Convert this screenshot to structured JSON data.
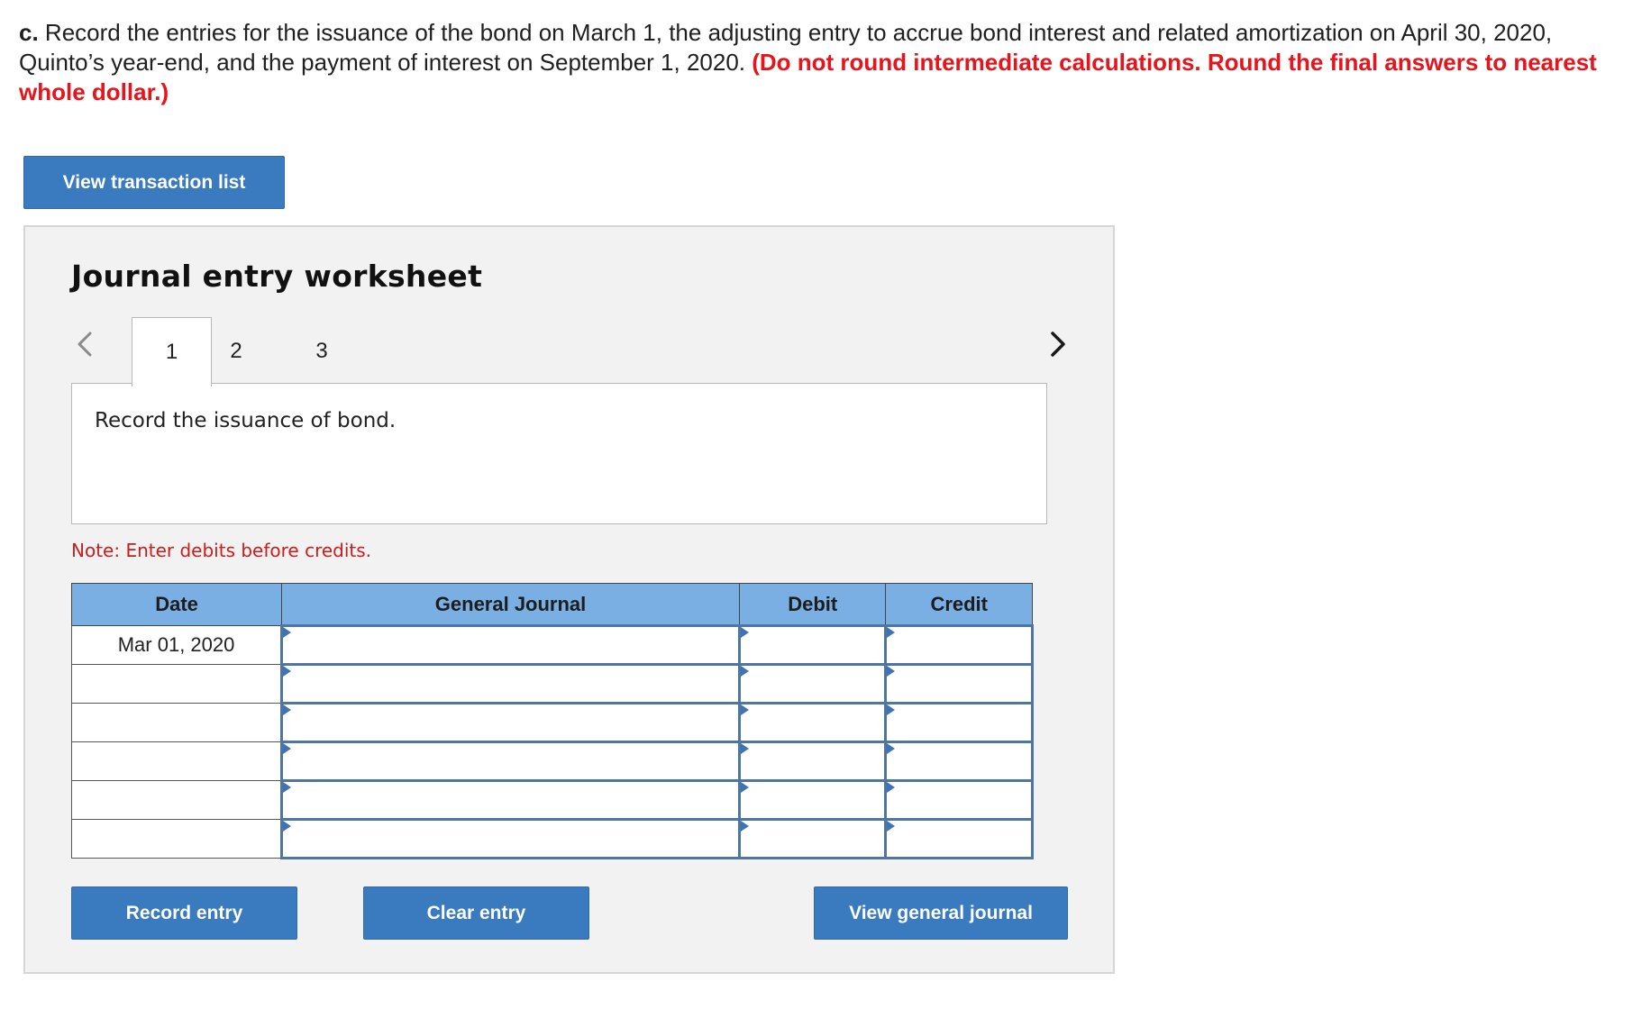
{
  "instructions": {
    "part_label": "c.",
    "text": " Record the entries for the issuance of the bond on March 1, the adjusting entry to accrue bond interest and related amortization on April 30, 2020, Quinto’s year-end, and the payment of interest on September 1, 2020. ",
    "red_text": "(Do not round intermediate calculations. Round the final answers to nearest whole dollar.)"
  },
  "buttons": {
    "view_transaction_list": "View transaction list",
    "record_entry": "Record entry",
    "clear_entry": "Clear entry",
    "view_general_journal": "View general journal"
  },
  "worksheet": {
    "title": "Journal entry worksheet",
    "tabs": [
      {
        "label": "1",
        "active": true
      },
      {
        "label": "2",
        "active": false
      },
      {
        "label": "3",
        "active": false
      }
    ],
    "prompt": "Record the issuance of bond.",
    "note": "Note: Enter debits before credits."
  },
  "journal": {
    "headers": {
      "date": "Date",
      "general_journal": "General Journal",
      "debit": "Debit",
      "credit": "Credit"
    },
    "rows": [
      {
        "date": "Mar 01, 2020",
        "account": "",
        "debit": "",
        "credit": ""
      },
      {
        "date": "",
        "account": "",
        "debit": "",
        "credit": ""
      },
      {
        "date": "",
        "account": "",
        "debit": "",
        "credit": ""
      },
      {
        "date": "",
        "account": "",
        "debit": "",
        "credit": ""
      },
      {
        "date": "",
        "account": "",
        "debit": "",
        "credit": ""
      },
      {
        "date": "",
        "account": "",
        "debit": "",
        "credit": ""
      }
    ]
  },
  "colors": {
    "button_blue": "#3a7bbf",
    "header_blue": "#7aafe3",
    "alert_red": "#e8141b",
    "note_red": "#c81e1e",
    "panel_gray": "#f2f2f2"
  },
  "icons": {
    "prev": "chevron-left-icon",
    "next": "chevron-right-icon"
  }
}
